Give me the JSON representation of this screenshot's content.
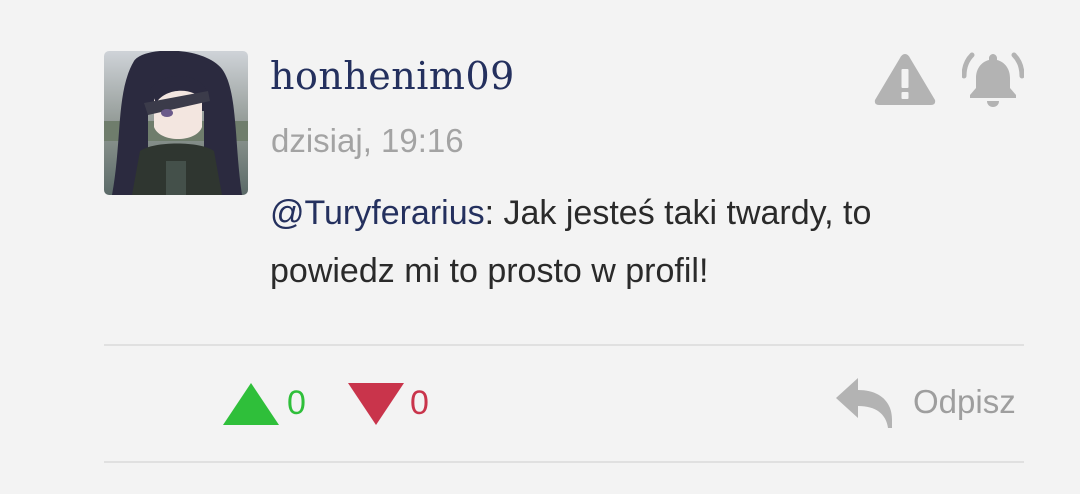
{
  "comment": {
    "username": "honhenim09",
    "timestamp": "dzisiaj, 19:16",
    "mention": "@Turyferarius",
    "text": ": Jak jesteś taki twardy, to powiedz mi to prosto w profil!",
    "avatar_icon": "avatar-image"
  },
  "actions": {
    "report_icon": "warning-icon",
    "notify_icon": "bell-icon",
    "upvotes": "0",
    "downvotes": "0",
    "reply_label": "Odpisz"
  },
  "colors": {
    "username": "#24305e",
    "mention": "#24305e",
    "upvote": "#2fbf3a",
    "downvote": "#c9344b",
    "muted": "#a3a3a3",
    "icon_gray": "#b3b3b3",
    "background": "#f3f3f3"
  }
}
